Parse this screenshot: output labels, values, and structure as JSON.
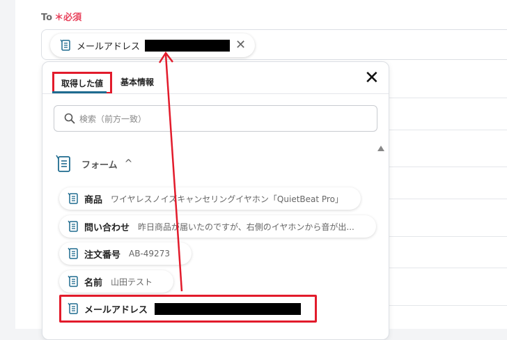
{
  "to_field": {
    "label": "To",
    "required_mark": "＊必須",
    "chip_label": "メールアドレス",
    "chip_icon": "document-icon",
    "remove_icon": "close-icon"
  },
  "picker": {
    "tabs": [
      {
        "label": "取得した値",
        "active": true
      },
      {
        "label": "基本情報",
        "active": false
      }
    ],
    "close_icon": "close-icon",
    "search": {
      "placeholder": "検索（前方一致）",
      "icon": "search-icon"
    },
    "section": {
      "title": "フォーム",
      "expanded": true
    },
    "items": [
      {
        "name": "商品",
        "value": "ワイヤレスノイズキャンセリングイヤホン「QuietBeat Pro」"
      },
      {
        "name": "問い合わせ",
        "value": "昨日商品が届いたのですが、右側のイヤホンから音が出..."
      },
      {
        "name": "注文番号",
        "value": "AB-49273"
      },
      {
        "name": "名前",
        "value": "山田テスト"
      },
      {
        "name": "メールアドレス",
        "value": ""
      }
    ]
  },
  "colors": {
    "highlight": "#e21b2b",
    "required": "#e8415b",
    "accent": "#1f6b8f"
  }
}
